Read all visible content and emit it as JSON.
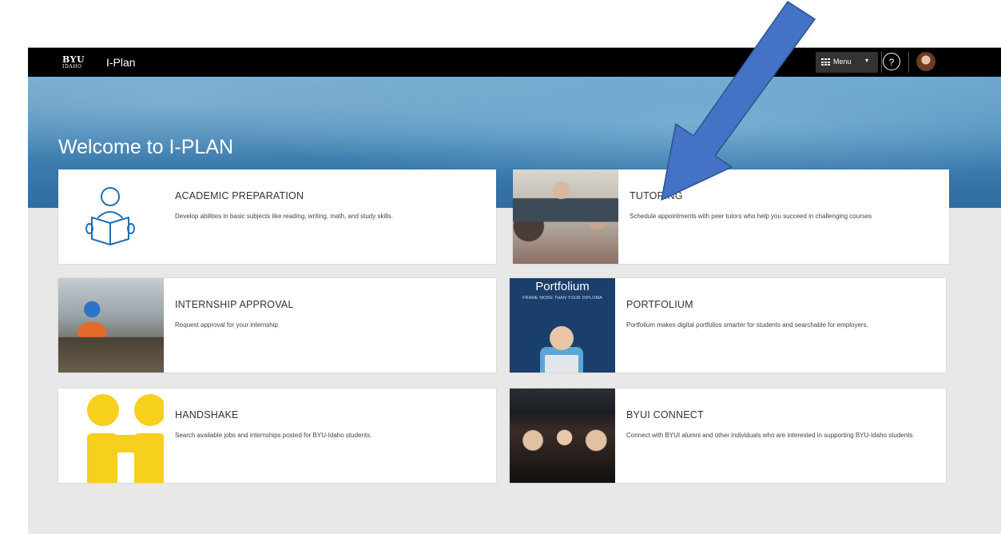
{
  "topbar": {
    "logo_main": "BYU",
    "logo_sub": "IDAHO",
    "app_title": "I-Plan",
    "menu_label": "Menu",
    "menu_caret": "▾",
    "help_glyph": "?"
  },
  "hero": {
    "title": "Welcome to I-PLAN"
  },
  "cards": [
    {
      "title": "ACADEMIC PREPARATION",
      "description": "Develop abilities in basic subjects like reading, writing, math, and study skills."
    },
    {
      "title": "TUTORING",
      "description": "Schedule appointments with peer tutors who help you succeed in challenging courses"
    },
    {
      "title": "INTERNSHIP APPROVAL",
      "description": "Request approval for your internship"
    },
    {
      "title": "PORTFOLIUM",
      "description": "Portfolium makes digital portfolios smarter for students and searchable for employers.",
      "image_title": "Portfolium",
      "image_tagline": "FRAME MORE THAN YOUR DIPLOMA"
    },
    {
      "title": "HANDSHAKE",
      "description": "Search available jobs and internships posted for BYU-Idaho students."
    },
    {
      "title": "BYUI CONNECT",
      "description": "Connect with BYUI alumni and other individuals who are interested in supporting BYU-Idaho students."
    }
  ],
  "colors": {
    "topbar": "#000000",
    "hero_blue": "#3f7fb0",
    "page_gray": "#e8e8e8",
    "icon_blue": "#1f6fb2",
    "handshake_yellow": "#f7cf1d",
    "annotation_arrow": "#4472c4"
  },
  "icons": {
    "menu": "grid-icon",
    "help": "question-icon",
    "academic": "reading-person-icon"
  }
}
